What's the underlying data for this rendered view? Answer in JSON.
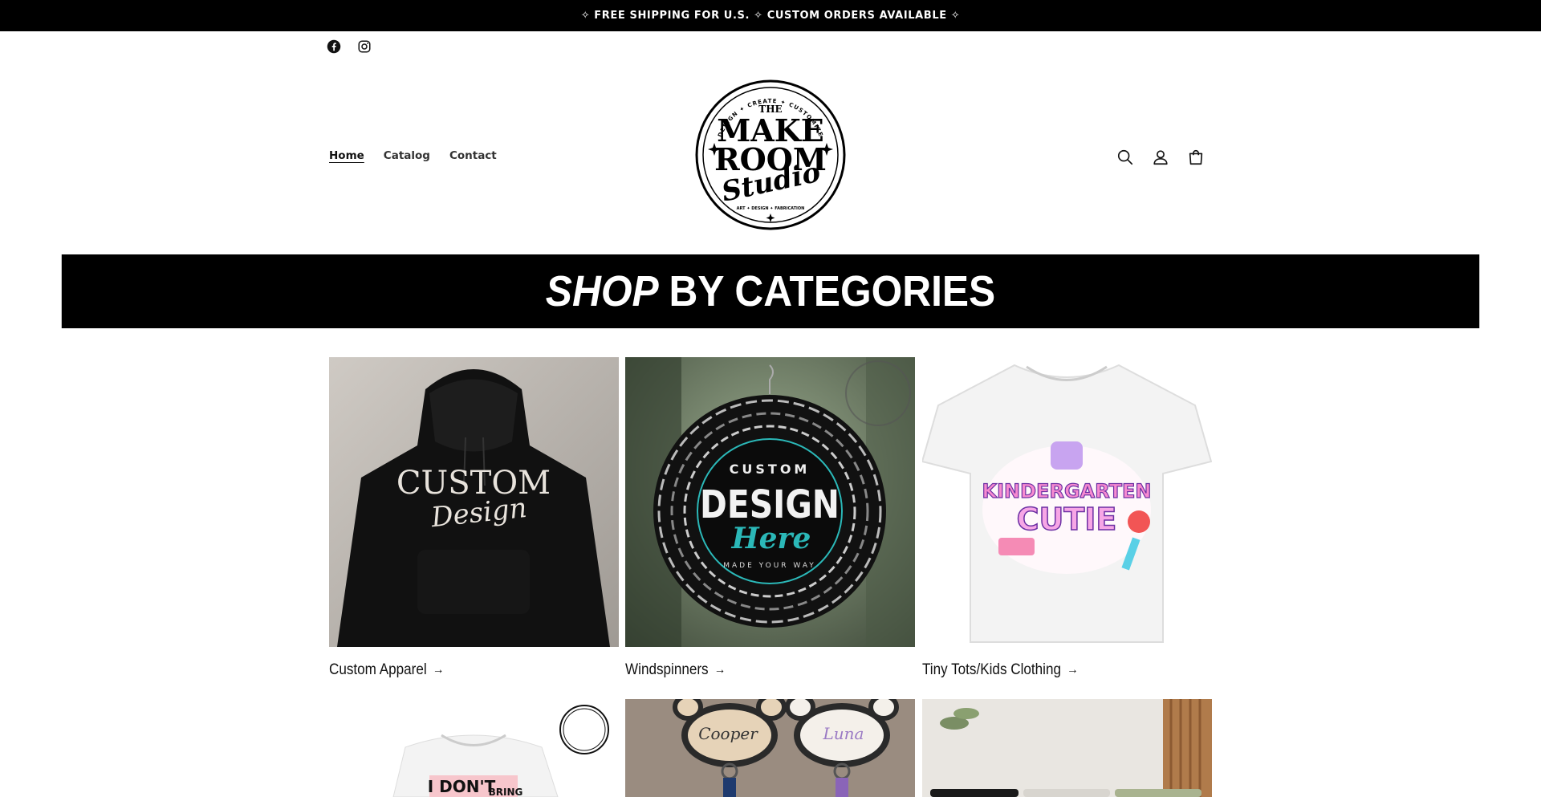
{
  "announcement": {
    "text": "✧ FREE SHIPPING FOR U.S. ✧ CUSTOM ORDERS AVAILABLE ✧"
  },
  "social": [
    {
      "name": "facebook-icon"
    },
    {
      "name": "instagram-icon"
    }
  ],
  "nav": [
    {
      "label": "Home",
      "active": true
    },
    {
      "label": "Catalog",
      "active": false
    },
    {
      "label": "Contact",
      "active": false
    }
  ],
  "logo": {
    "line1": "THE",
    "line2": "MAKE",
    "line3": "ROOM",
    "line4": "Studio",
    "ring_text": "DESIGN ✦ CREATE ✦ CUSTOMIZE",
    "bottom_text": "ART ✦ DESIGN ✦ FABRICATION"
  },
  "header_icons": [
    "search-icon",
    "account-icon",
    "cart-icon"
  ],
  "categories_banner": {
    "em": "SHOP",
    "rest": "BY CATEGORIES"
  },
  "categories": [
    {
      "label": "Custom Apparel",
      "arrow": "→",
      "image_text": [
        "CUSTOM",
        "Design"
      ]
    },
    {
      "label": "Windspinners",
      "arrow": "→",
      "image_text": [
        "CUSTOM",
        "DESIGN",
        "Here",
        "MADE YOUR WAY"
      ]
    },
    {
      "label": "Tiny Tots/Kids Clothing",
      "arrow": "→",
      "image_text": [
        "KINDERGARTEN",
        "CUTIE"
      ]
    }
  ],
  "row2": [
    {
      "image_text": [
        "I DON'T",
        "BRING"
      ]
    },
    {
      "image_text": [
        "Cooper",
        "Luna"
      ]
    },
    {
      "image_text": []
    }
  ],
  "colors": {
    "banner_bg": "#000000",
    "text": "#121212",
    "accent_teal": "#2bb8b8"
  }
}
